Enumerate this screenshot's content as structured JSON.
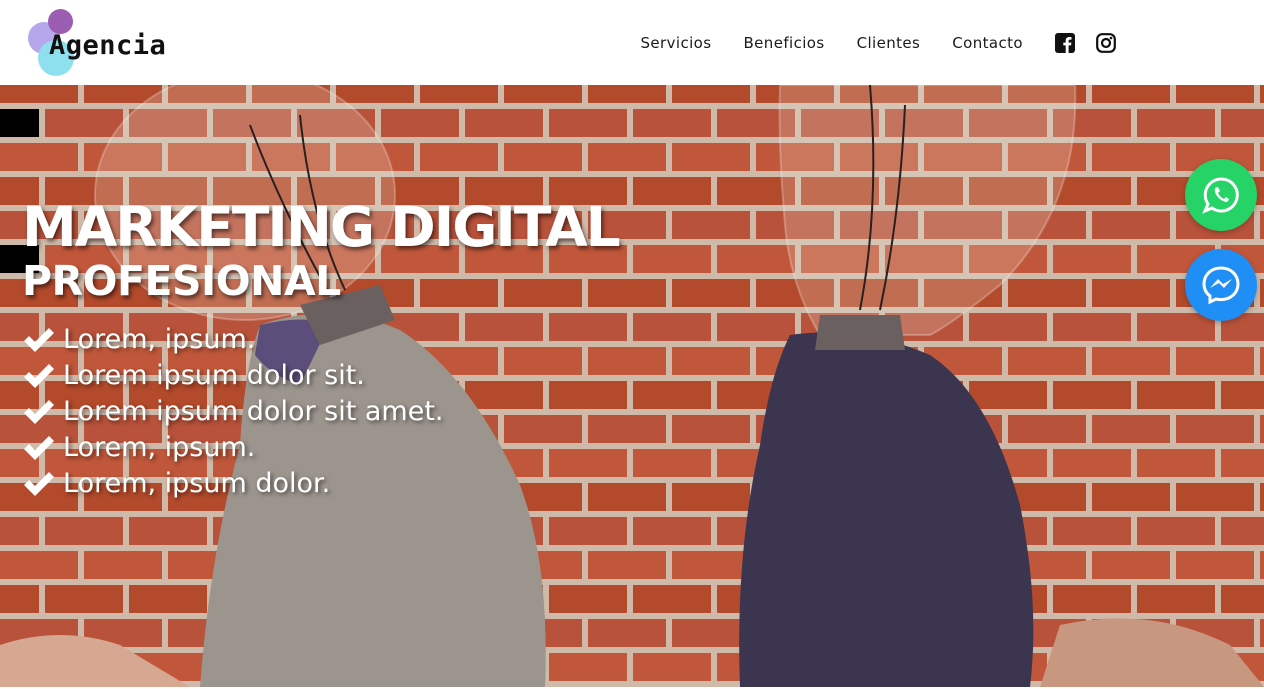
{
  "brand": {
    "logo_text": "Agencia"
  },
  "nav": {
    "items": [
      {
        "label": "Servicios"
      },
      {
        "label": "Beneficios"
      },
      {
        "label": "Clientes"
      },
      {
        "label": "Contacto"
      }
    ],
    "social": [
      {
        "icon": "facebook-icon"
      },
      {
        "icon": "instagram-icon"
      }
    ]
  },
  "hero": {
    "title": "MARKETING DIGITAL",
    "subtitle": "PROFESIONAL",
    "features": [
      "Lorem, ipsum.",
      "Lorem ipsum dolor sit.",
      "Lorem ipsum dolor sit amet.",
      "Lorem, ipsum.",
      "Lorem, ipsum dolor."
    ]
  },
  "floating_buttons": [
    {
      "icon": "whatsapp-icon",
      "color": "#25d366"
    },
    {
      "icon": "messenger-icon",
      "color": "#1f8ff5"
    }
  ],
  "colors": {
    "brick": "#a9452a",
    "logo_purple": "#9b5db1",
    "logo_lavender": "#b6a6ea",
    "logo_cyan": "#8fe0ef"
  }
}
